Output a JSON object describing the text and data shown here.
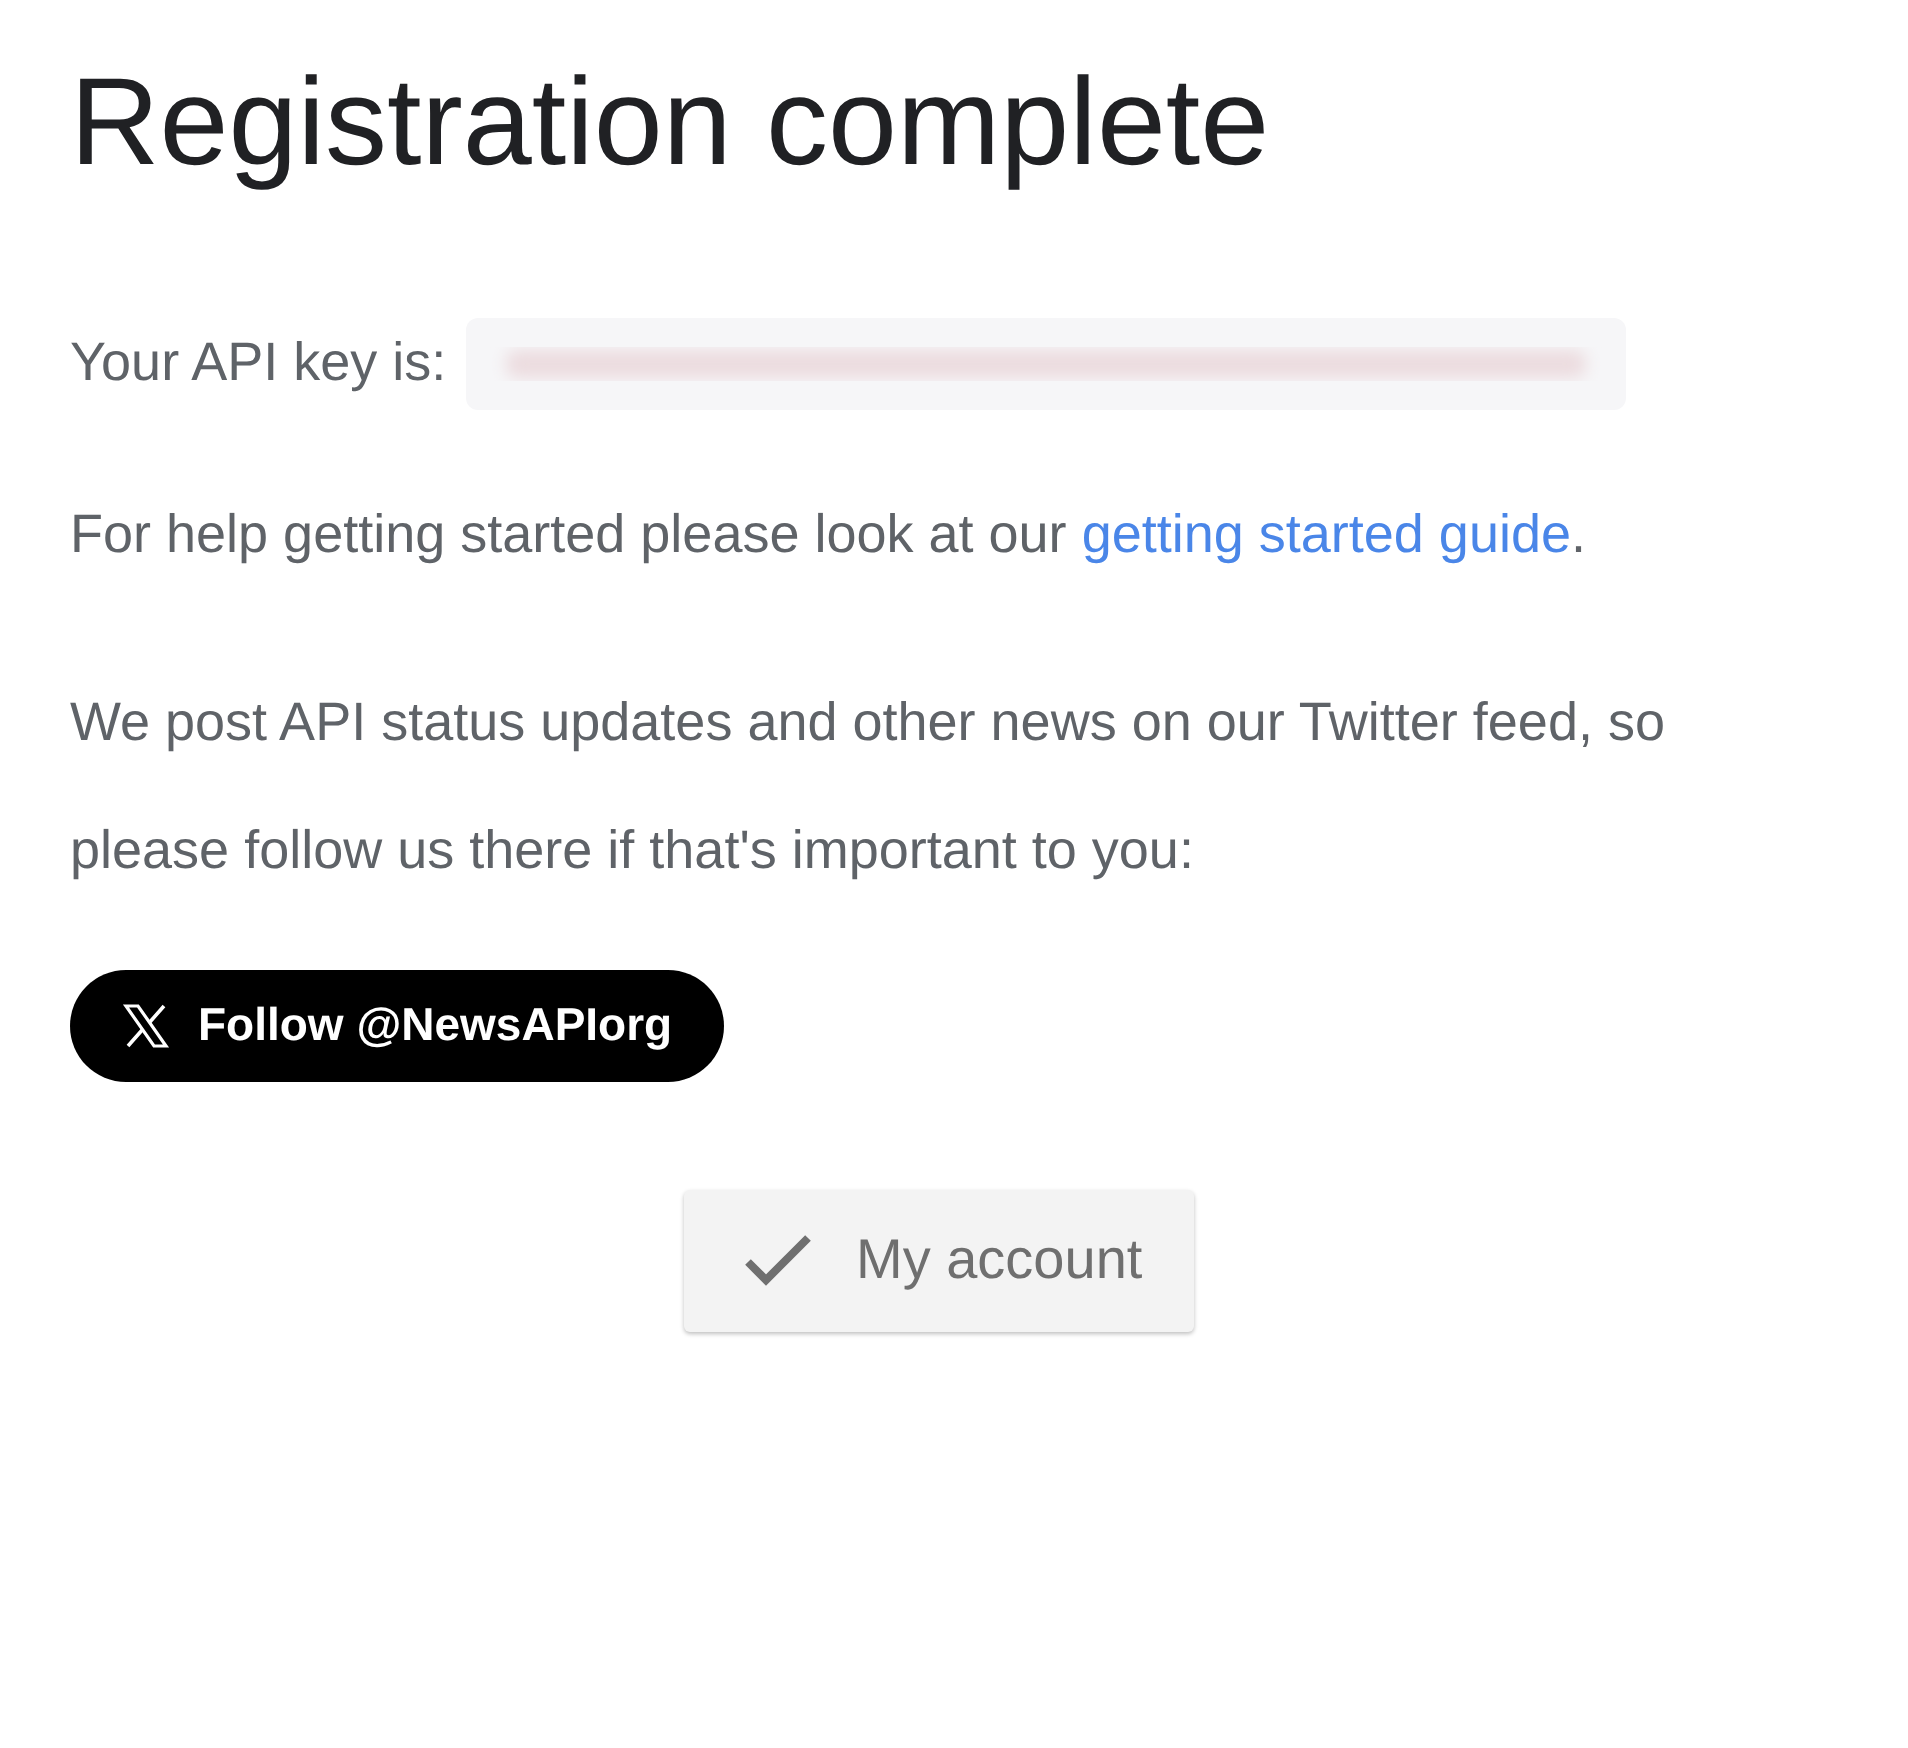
{
  "title": "Registration complete",
  "api_key": {
    "label": "Your API key is:",
    "redacted": true
  },
  "help": {
    "before": "For help getting started please look at our ",
    "link": "getting started guide",
    "after": "."
  },
  "twitter_note": "We post API status updates and other news on our Twitter feed, so please follow us there if that's important to you:",
  "follow_button": {
    "label": "Follow @NewsAPIorg"
  },
  "account_button": {
    "label": "My account"
  }
}
